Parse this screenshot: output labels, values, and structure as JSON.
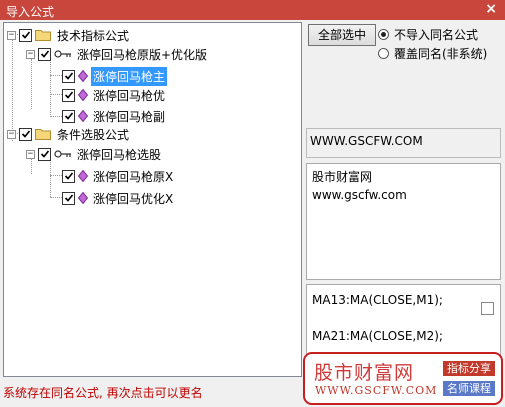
{
  "window": {
    "title": "导入公式",
    "close_glyph": "×"
  },
  "tree": {
    "groups": [
      {
        "label": "技术指标公式",
        "checked": true,
        "expanded": true,
        "formula": {
          "label": "涨停回马枪原版+优化版",
          "checked": true,
          "expanded": true,
          "items": [
            {
              "label": "涨停回马枪主",
              "checked": true,
              "selected": true
            },
            {
              "label": "涨停回马枪优",
              "checked": true
            },
            {
              "label": "涨停回马枪副",
              "checked": true
            }
          ]
        }
      },
      {
        "label": "条件选股公式",
        "checked": true,
        "expanded": true,
        "formula": {
          "label": "涨停回马枪选股",
          "checked": true,
          "expanded": true,
          "items": [
            {
              "label": "涨停回马枪原X",
              "checked": true
            },
            {
              "label": "涨停回马优化X",
              "checked": true
            }
          ]
        }
      }
    ]
  },
  "options": {
    "select_all_label": "全部选中",
    "radio_no_import": "不导入同名公式",
    "radio_overwrite": "覆盖同名(非系统)",
    "selected": "不导入同名公式"
  },
  "info": {
    "url": "WWW.GSCFW.COM",
    "desc_lines": [
      "股市财富网",
      "www.gscfw.com"
    ],
    "code_lines": [
      "MA13:MA(CLOSE,M1);",
      "MA21:MA(CLOSE,M2);"
    ]
  },
  "status": "系统存在同名公式, 再次点击可以更名",
  "watermark": {
    "name": "股市财富网",
    "url": "WWW.GSCFW.COM",
    "tag1": "指标分享",
    "tag2": "名师课程"
  }
}
